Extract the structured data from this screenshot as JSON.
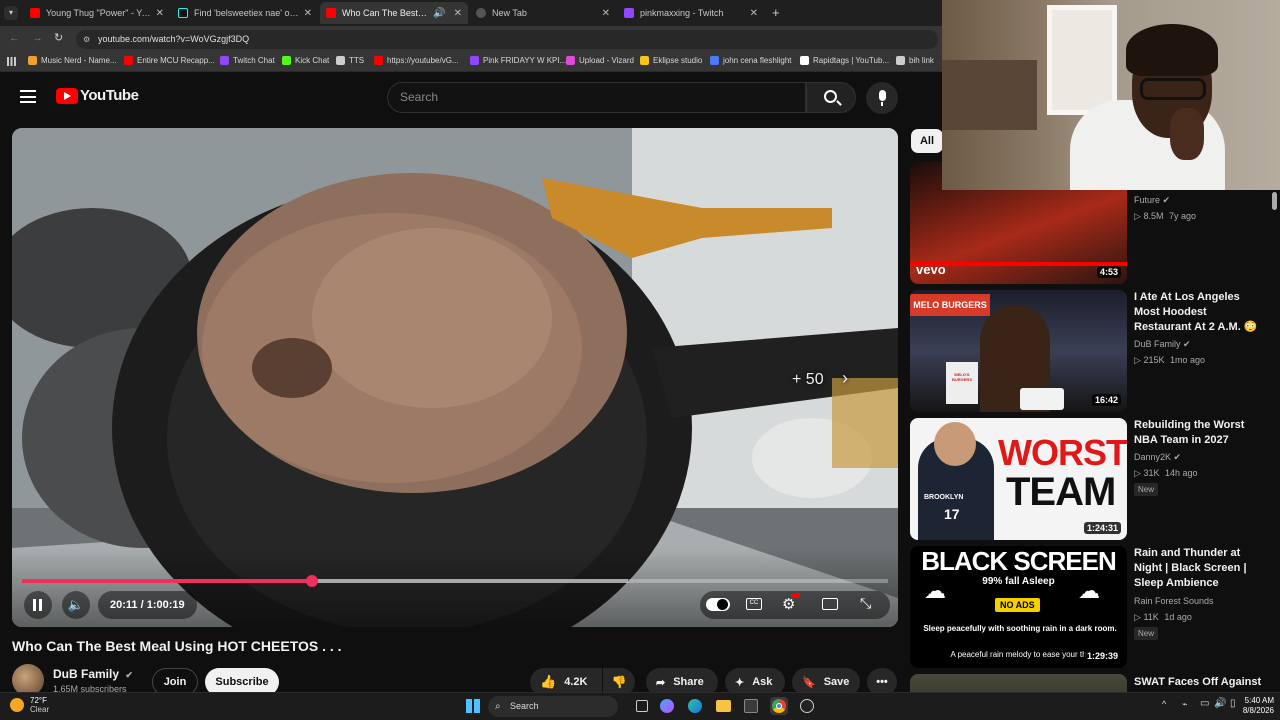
{
  "browser": {
    "tabs": [
      {
        "title": "Young Thug \"Power\" - YouTube",
        "color": "#ff0000"
      },
      {
        "title": "Find 'belsweetiex nae' on TikTok",
        "color": "#25f4ee"
      },
      {
        "title": "Who Can The Best Meal Using HOT CHEETOS",
        "color": "#ff0000",
        "active": true
      },
      {
        "title": "New Tab",
        "color": "#9aa0a6"
      },
      {
        "title": "pinkmaxxing - Twitch",
        "color": "#9146ff"
      }
    ],
    "url": "youtube.com/watch?v=WoVGzgjf3DQ",
    "bookmarks": [
      {
        "label": "Music Nerd - Name...",
        "color": "#f0a030"
      },
      {
        "label": "Entire MCU Recapp...",
        "color": "#ff0000"
      },
      {
        "label": "Twitch Chat",
        "color": "#9146ff"
      },
      {
        "label": "Kick Chat",
        "color": "#53fc18"
      },
      {
        "label": "TTS",
        "color": "#cccccc"
      },
      {
        "label": "https://youtube/vG...",
        "color": "#ff0000"
      },
      {
        "label": "Pink FRIDAYY W KPI...",
        "color": "#9146ff"
      },
      {
        "label": "Upload - Vizard",
        "color": "#e04ad8"
      },
      {
        "label": "Eklipse studio",
        "color": "#f5c518"
      },
      {
        "label": "john cena fleshlight",
        "color": "#4a7bff"
      },
      {
        "label": "Rapidtags | YouTub...",
        "color": "#ffffff"
      },
      {
        "label": "bih link",
        "color": "#cccccc"
      }
    ]
  },
  "youtube": {
    "logo_text": "YouTube",
    "search_placeholder": "Search",
    "filter_chip": "All"
  },
  "player": {
    "time_current": "20:11",
    "time_total": "1:00:19",
    "time_display": "20:11 / 1:00:19",
    "progress_fraction": 0.335,
    "buffered_fraction": 0.7,
    "skip_label": "+ 50"
  },
  "video": {
    "title": "Who Can The Best Meal Using HOT CHEETOS . . .",
    "channel": "DuB Family",
    "subscribers": "1.65M subscribers",
    "join_label": "Join",
    "subscribe_label": "Subscribe",
    "likes": "4.2K",
    "share_label": "Share",
    "ask_label": "Ask",
    "save_label": "Save"
  },
  "recommendations": [
    {
      "title": "",
      "channel": "Future",
      "views": "8.5M",
      "age": "7y ago",
      "duration": "4:53",
      "thumb_text": "vevo",
      "new": false
    },
    {
      "title": "I Ate At Los Angeles Most Hoodest Restaurant At 2 A.M. 😳",
      "channel": "DuB Family",
      "views": "215K",
      "age": "1mo ago",
      "duration": "16:42",
      "thumb_text": "MELO BURGERS",
      "new": false
    },
    {
      "title": "Rebuilding the Worst NBA Team in 2027",
      "channel": "Danny2K",
      "views": "31K",
      "age": "14h ago",
      "duration": "1:24:31",
      "thumb_text": "WORST TEAM",
      "new": true
    },
    {
      "title": "Rain and Thunder at Night | Black Screen | Sleep Ambience",
      "channel": "Rain Forest Sounds",
      "views": "11K",
      "age": "1d ago",
      "duration": "1:29:39",
      "thumb_text": "BLACK SCREEN",
      "new": true
    },
    {
      "title": "SWAT Faces Off Against",
      "channel": "",
      "views": "",
      "age": "",
      "duration": "",
      "thumb_text": "",
      "new": false
    }
  ],
  "rain_thumb": {
    "line1": "99% fall Asleep",
    "badge": "NO ADS",
    "line2": "Sleep peacefully with soothing rain in a dark room.",
    "line3": "A peaceful rain melody to ease your th"
  },
  "worst_thumb": {
    "line1": "WORST",
    "line2": "TEAM",
    "jersey_text": "BROOKLYN",
    "jersey_number": "17"
  },
  "melo_thumb": {
    "sign": "MELO BURGERS",
    "bag": "MELO'S BURGERS"
  },
  "new_label": "New",
  "taskbar": {
    "weather_temp": "72°F",
    "weather_desc": "Clear",
    "search_label": "Search",
    "time": "5:40 AM",
    "date": "8/8/2026"
  }
}
